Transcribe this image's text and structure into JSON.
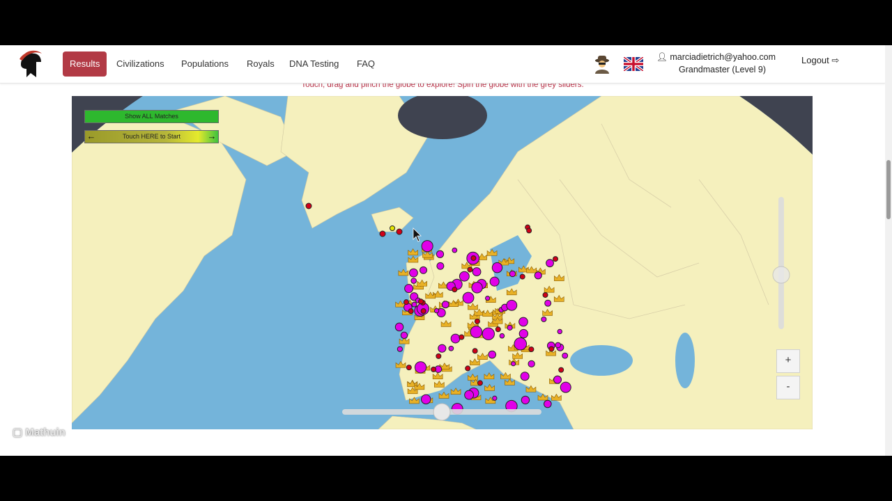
{
  "nav": {
    "items": [
      {
        "label": "Results",
        "active": true
      },
      {
        "label": "Civilizations",
        "active": false
      },
      {
        "label": "Populations",
        "active": false
      },
      {
        "label": "Royals",
        "active": false
      },
      {
        "label": "DNA Testing",
        "active": false
      },
      {
        "label": "FAQ",
        "active": false
      }
    ]
  },
  "user": {
    "email": "marciadietrich@yahoo.com",
    "level": "Grandmaster (Level 9)",
    "logout_label": "Logout"
  },
  "map": {
    "hint": "Touch, drag and pinch the globe to explore! Spin the globe with the grey sliders.",
    "show_all_label": "Show ALL Matches",
    "start_label": "Touch HERE to Start",
    "left_arrow": "←",
    "right_arrow": "→",
    "zoom_in": "+",
    "zoom_out": "-"
  },
  "watermark": "Mathuin",
  "colors": {
    "accent": "#b23a45",
    "ocean": "#74b4da",
    "land": "#f5f0bd",
    "marker": "#e100e8",
    "green_button": "#2eb82e"
  }
}
